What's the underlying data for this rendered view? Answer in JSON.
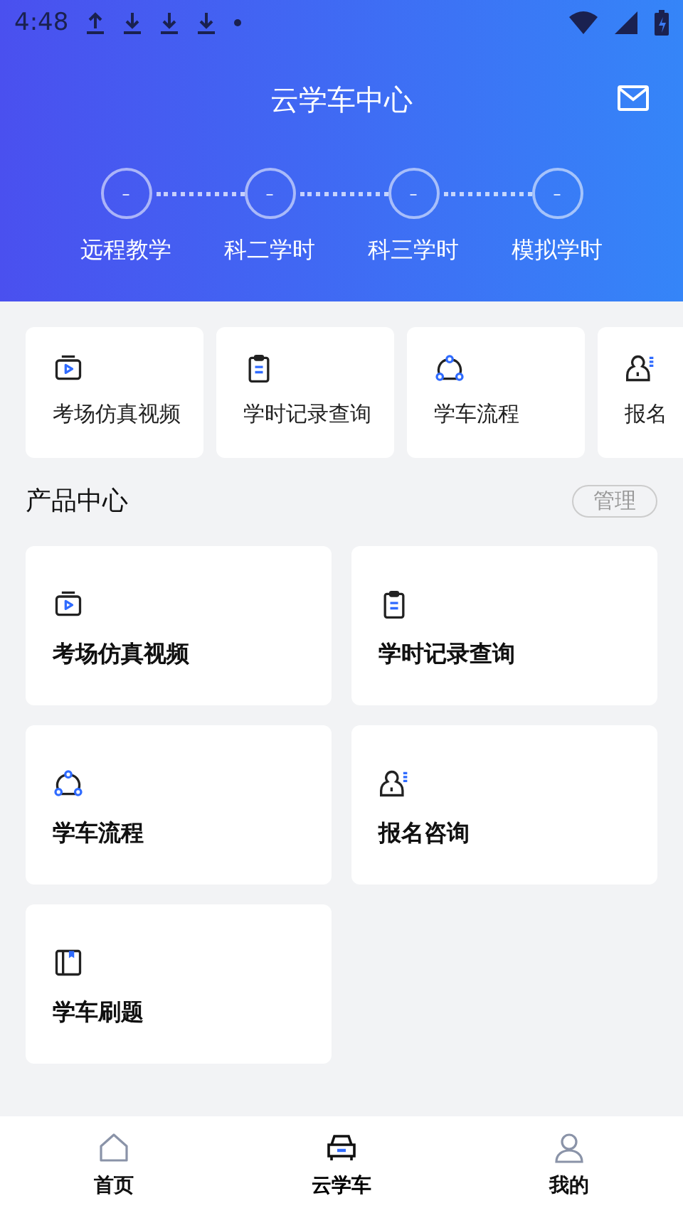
{
  "status_bar": {
    "time": "4:48"
  },
  "header": {
    "title": "云学车中心"
  },
  "steps": [
    {
      "value": "–",
      "label": "远程教学"
    },
    {
      "value": "–",
      "label": "科二学时"
    },
    {
      "value": "–",
      "label": "科三学时"
    },
    {
      "value": "–",
      "label": "模拟学时"
    }
  ],
  "quick_links": [
    {
      "kind": "video",
      "label": "考场仿真视频"
    },
    {
      "kind": "clipboard",
      "label": "学时记录查询"
    },
    {
      "kind": "flow",
      "label": "学车流程"
    },
    {
      "kind": "person",
      "label": "报名"
    }
  ],
  "section": {
    "title": "产品中心",
    "action": "管理"
  },
  "products": [
    {
      "kind": "video",
      "label": "考场仿真视频"
    },
    {
      "kind": "clipboard",
      "label": "学时记录查询"
    },
    {
      "kind": "flow",
      "label": "学车流程"
    },
    {
      "kind": "person",
      "label": "报名咨询"
    },
    {
      "kind": "book",
      "label": "学车刷题"
    }
  ],
  "tab_bar": [
    {
      "kind": "home",
      "label": "首页",
      "selected": false
    },
    {
      "kind": "car",
      "label": "云学车",
      "selected": true
    },
    {
      "kind": "person",
      "label": "我的",
      "selected": false
    }
  ]
}
